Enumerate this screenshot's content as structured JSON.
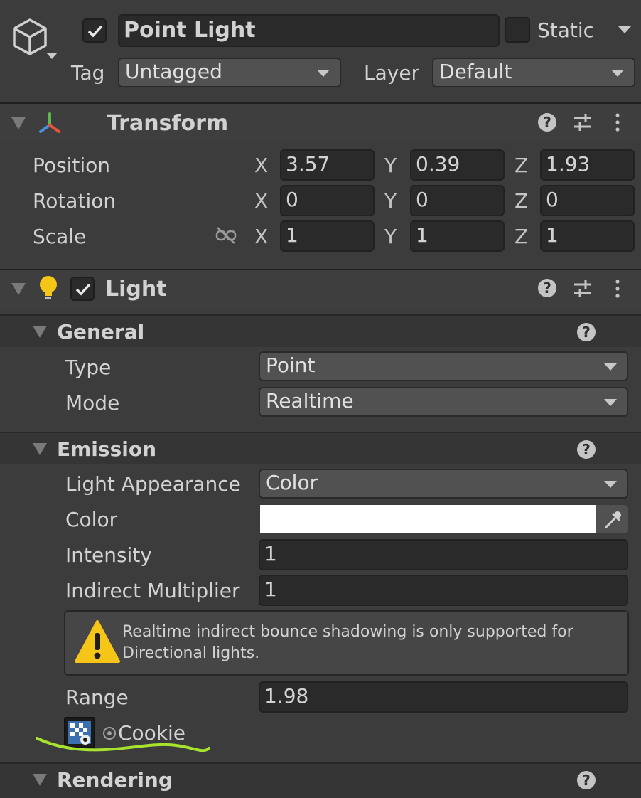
{
  "object": {
    "name": "Point Light",
    "active": true,
    "static_label": "Static",
    "tag_label": "Tag",
    "tag_value": "Untagged",
    "layer_label": "Layer",
    "layer_value": "Default"
  },
  "transform": {
    "title": "Transform",
    "rows": [
      {
        "label": "Position",
        "x": "3.57",
        "y": "0.39",
        "z": "1.93"
      },
      {
        "label": "Rotation",
        "x": "0",
        "y": "0",
        "z": "0"
      },
      {
        "label": "Scale",
        "x": "1",
        "y": "1",
        "z": "1"
      }
    ],
    "axes": {
      "x": "X",
      "y": "Y",
      "z": "Z"
    }
  },
  "light": {
    "title": "Light",
    "enabled": true,
    "general": {
      "title": "General",
      "type_label": "Type",
      "type_value": "Point",
      "mode_label": "Mode",
      "mode_value": "Realtime"
    },
    "emission": {
      "title": "Emission",
      "appearance_label": "Light Appearance",
      "appearance_value": "Color",
      "color_label": "Color",
      "color_value": "#ffffff",
      "intensity_label": "Intensity",
      "intensity_value": "1",
      "indirect_label": "Indirect Multiplier",
      "indirect_value": "1",
      "warning": "Realtime indirect bounce shadowing is only supported for Directional lights.",
      "range_label": "Range",
      "range_value": "1.98",
      "cookie_label": "Cookie"
    },
    "rendering": {
      "title": "Rendering"
    }
  },
  "colors": {
    "background": "#3c3c3c",
    "field": "#2a2a2a",
    "dropdown": "#515151",
    "annotation": "#a6e22e",
    "warning": "#f5c518"
  }
}
